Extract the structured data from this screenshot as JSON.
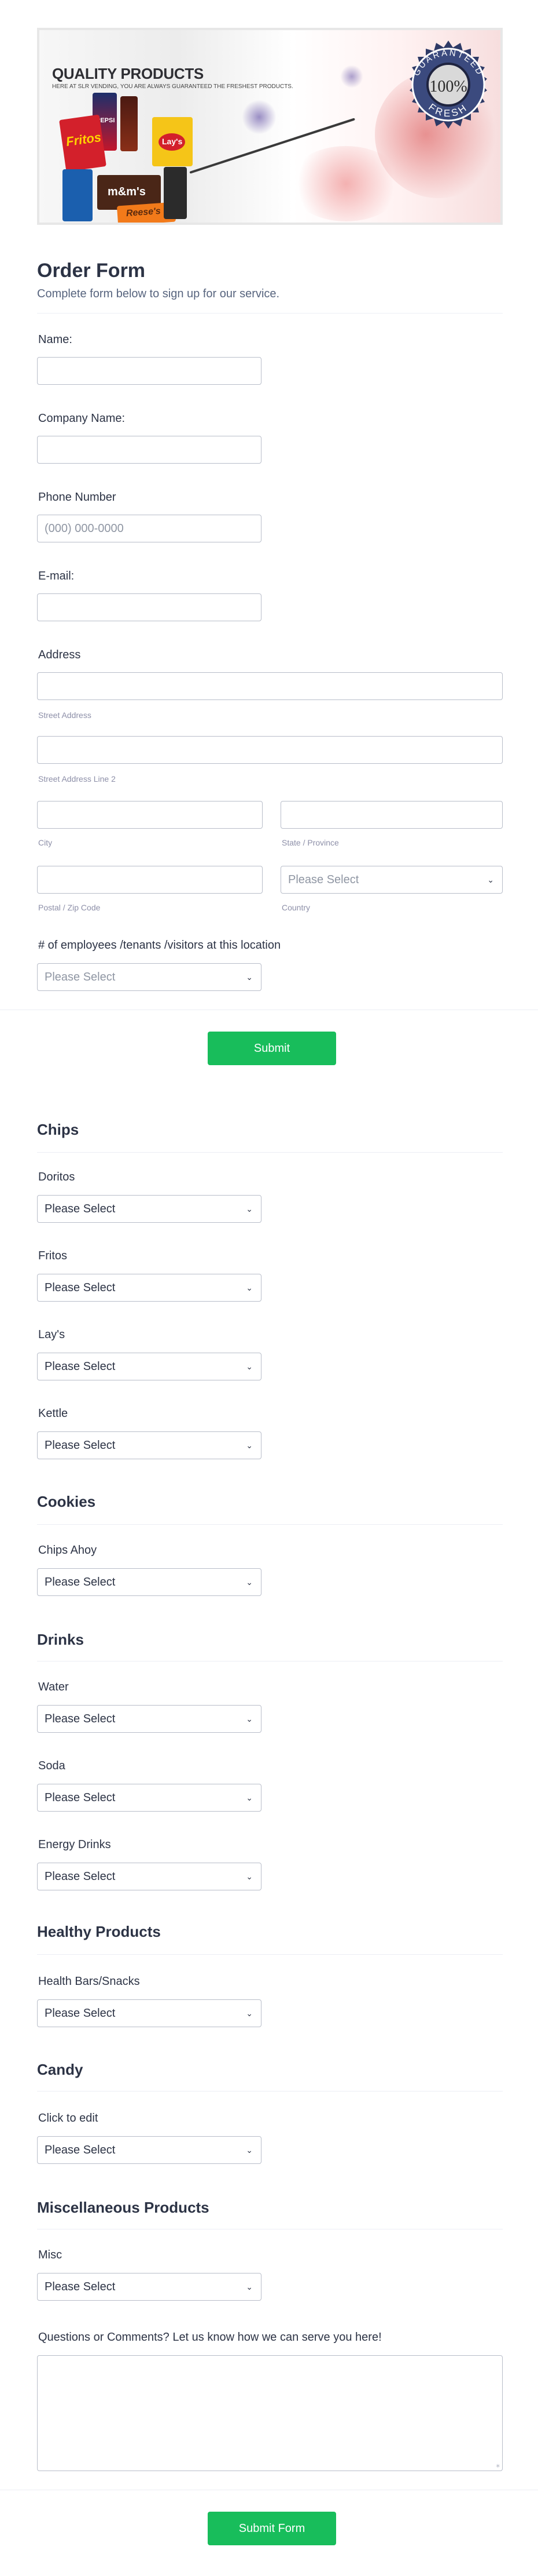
{
  "banner": {
    "headline": "QUALITY PRODUCTS",
    "tagline": "HERE AT SLR VENDING, YOU ARE ALWAYS GUARANTEED THE FRESHEST PRODUCTS.",
    "seal": {
      "top": "GUARANTEED",
      "middle": "100%",
      "bottom": "FRESH"
    },
    "products": {
      "fritos": "Fritos",
      "lays": "Lay's",
      "pepsi": "PEPSI",
      "mms": "m&m's",
      "reeses": "Reese's"
    }
  },
  "form": {
    "title": "Order Form",
    "subtitle": "Complete form below to sign up for our service.",
    "name_label": "Name:",
    "company_label": "Company Name:",
    "phone_label": "Phone Number",
    "phone_placeholder": "(000) 000-0000",
    "email_label": "E-mail:",
    "address_label": "Address",
    "street_sublabel": "Street Address",
    "street2_sublabel": "Street Address Line 2",
    "city_sublabel": "City",
    "state_sublabel": "State / Province",
    "postal_sublabel": "Postal / Zip Code",
    "country_sublabel": "Country",
    "country_placeholder": "Please Select",
    "employees_label": "# of employees /tenants /visitors at this location",
    "employees_placeholder": "Please Select",
    "submit_label": "Submit"
  },
  "select_default": "Please Select",
  "sections": {
    "chips": {
      "title": "Chips",
      "items": [
        "Doritos",
        "Fritos",
        "Lay's",
        "Kettle"
      ]
    },
    "cookies": {
      "title": "Cookies",
      "items": [
        "Chips Ahoy"
      ]
    },
    "drinks": {
      "title": "Drinks",
      "items": [
        "Water",
        "Soda",
        "Energy Drinks"
      ]
    },
    "healthy": {
      "title": "Healthy Products",
      "items": [
        "Health Bars/Snacks"
      ]
    },
    "candy": {
      "title": "Candy",
      "items": [
        "Click to edit"
      ]
    },
    "misc": {
      "title": "Miscellaneous Products",
      "items": [
        "Misc"
      ]
    }
  },
  "comments_label": "Questions or Comments? Let us know how we can serve you here!",
  "final_submit_label": "Submit Form",
  "colors": {
    "accent": "#18bd5b",
    "text": "#2c3345",
    "sublabel": "#8d8fa8",
    "border": "#b8bdc9"
  }
}
